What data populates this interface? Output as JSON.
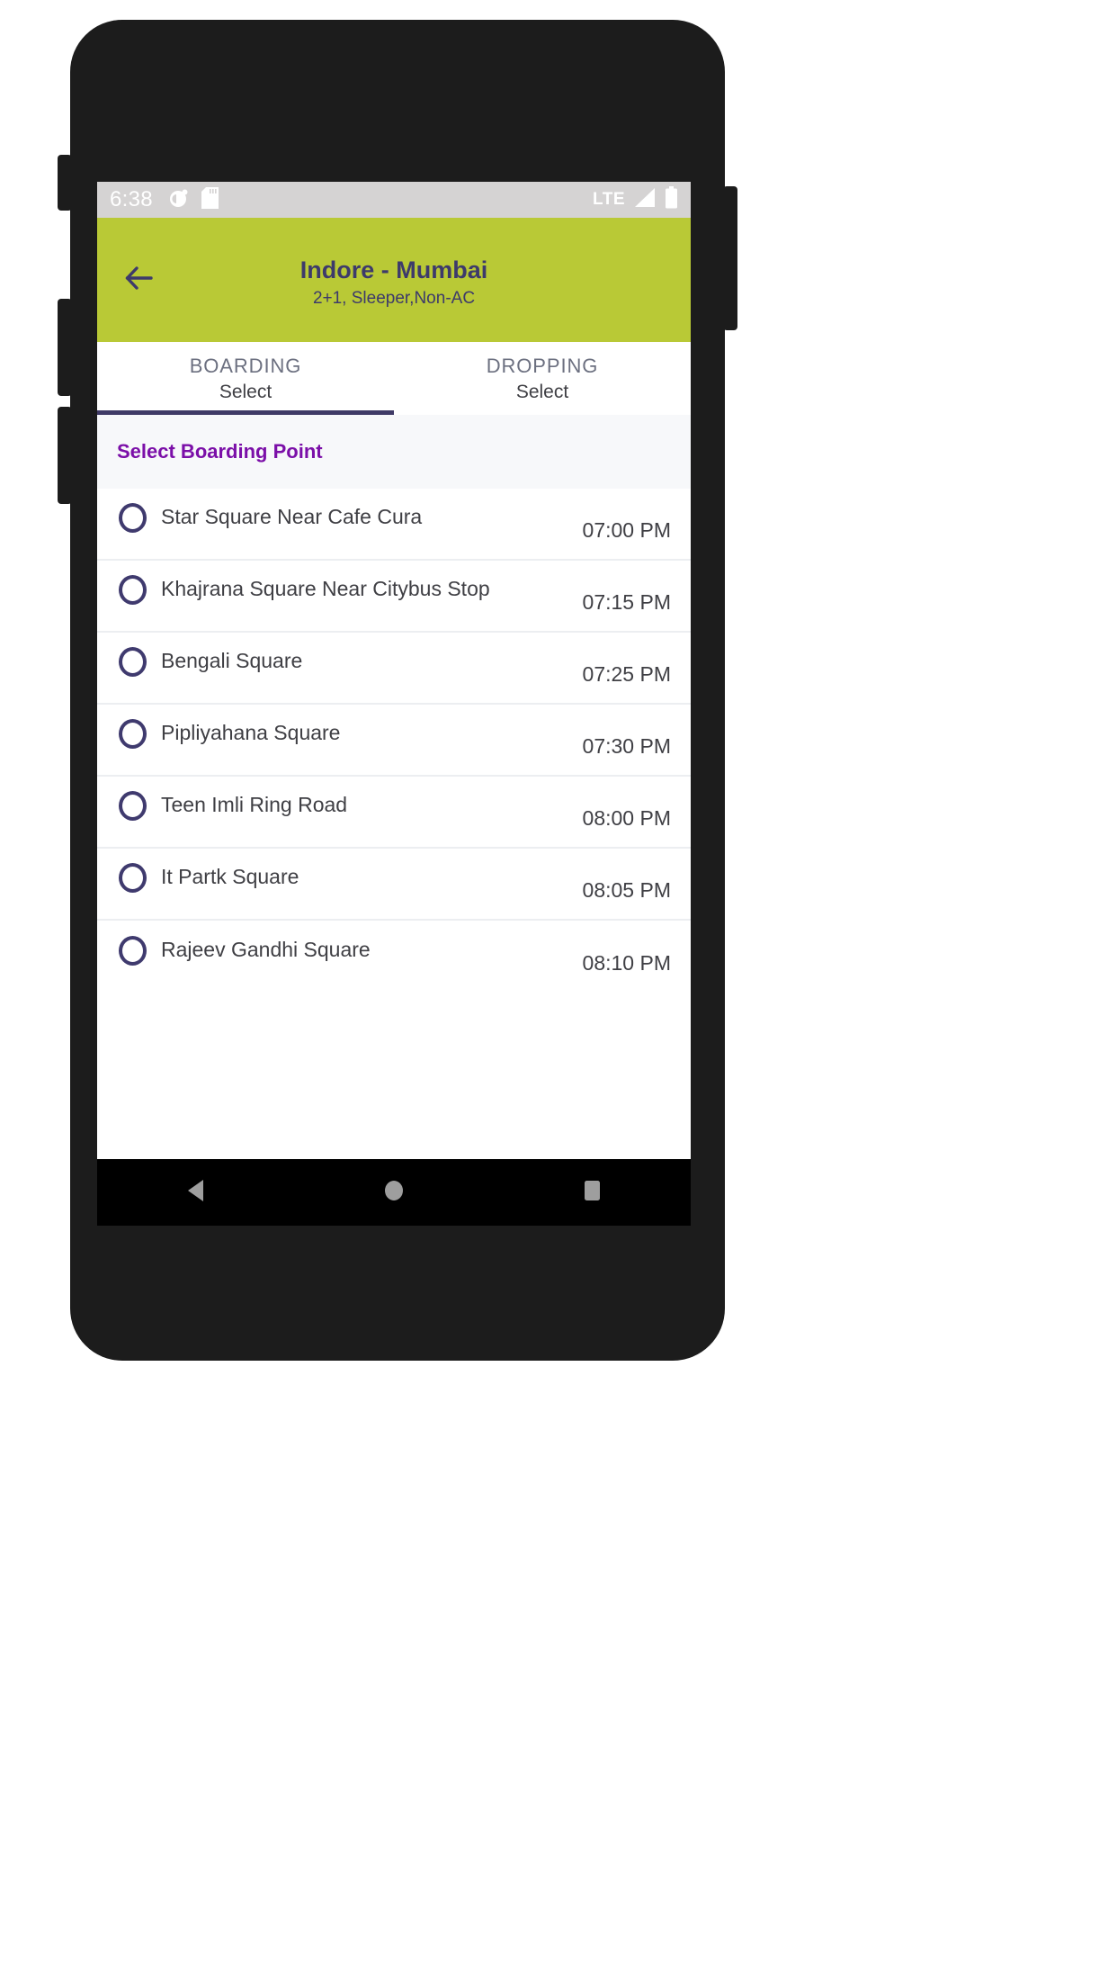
{
  "status_bar": {
    "clock": "6:38",
    "left_icons": [
      "app-circle-icon",
      "sd-card-icon"
    ],
    "network_label": "LTE",
    "right_icons": [
      "signal-icon",
      "battery-icon"
    ],
    "background_color": "#d5d3d3",
    "text_color": "#ffffff"
  },
  "app_bar": {
    "back_icon": "arrow-left-icon",
    "title": "Indore - Mumbai",
    "subtitle": "2+1, Sleeper,Non-AC",
    "background_color": "#b9c936",
    "text_color": "#3d3a6b"
  },
  "tabs": [
    {
      "title": "BOARDING",
      "subtitle": "Select",
      "active": true
    },
    {
      "title": "DROPPING",
      "subtitle": "Select",
      "active": false
    }
  ],
  "tab_indicator_color": "#3f3a66",
  "section": {
    "title": "Select Boarding Point",
    "title_color": "#7b0fa8",
    "background_color": "#f7f8fa"
  },
  "boarding_points": [
    {
      "name": "Star Square Near Cafe Cura",
      "time": "07:00 PM",
      "selected": false
    },
    {
      "name": "Khajrana Square Near Citybus Stop",
      "time": "07:15 PM",
      "selected": false
    },
    {
      "name": "Bengali Square",
      "time": "07:25 PM",
      "selected": false
    },
    {
      "name": "Pipliyahana Square",
      "time": "07:30 PM",
      "selected": false
    },
    {
      "name": "Teen Imli Ring Road",
      "time": "08:00 PM",
      "selected": false
    },
    {
      "name": "It Partk Square",
      "time": "08:05 PM",
      "selected": false
    },
    {
      "name": "Rajeev Gandhi Square",
      "time": "08:10 PM",
      "selected": false
    }
  ],
  "radio_color": "#3f3a6e",
  "nav_bar": {
    "background_color": "#000000",
    "buttons": [
      "back-triangle-icon",
      "home-circle-icon",
      "recents-square-icon"
    ],
    "icon_color": "#9e9e9e"
  }
}
